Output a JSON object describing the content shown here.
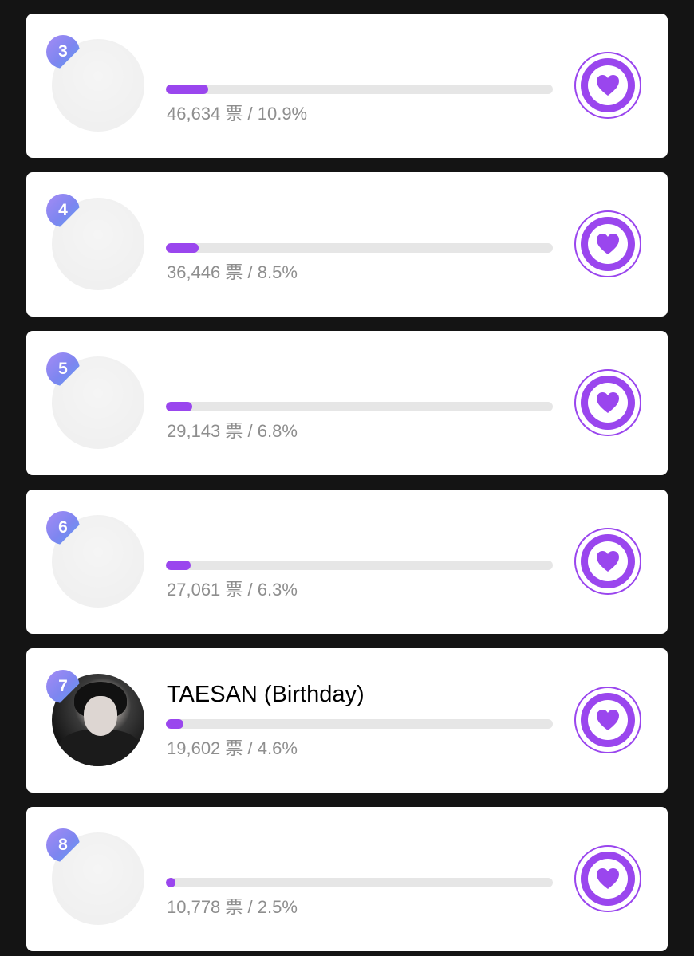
{
  "colors": {
    "background": "#141414",
    "card": "#ffffff",
    "accent": "#9a46ee",
    "progress_track": "#e6e6e6",
    "votes_text": "#8e8e8e"
  },
  "entries": [
    {
      "rank": "3",
      "name": "",
      "votes_text": "46,634 票 / 10.9%",
      "share": 0.109,
      "icon": "heart-icon"
    },
    {
      "rank": "4",
      "name": "",
      "votes_text": "36,446 票 / 8.5%",
      "share": 0.085,
      "icon": "heart-icon"
    },
    {
      "rank": "5",
      "name": "",
      "votes_text": "29,143 票 / 6.8%",
      "share": 0.068,
      "icon": "heart-icon"
    },
    {
      "rank": "6",
      "name": "",
      "votes_text": "27,061 票 / 6.3%",
      "share": 0.063,
      "icon": "heart-icon"
    },
    {
      "rank": "7",
      "name": "TAESAN (Birthday)",
      "votes_text": "19,602 票 / 4.6%",
      "share": 0.046,
      "icon": "heart-icon"
    },
    {
      "rank": "8",
      "name": "",
      "votes_text": "10,778 票 / 2.5%",
      "share": 0.025,
      "icon": "heart-icon"
    }
  ]
}
